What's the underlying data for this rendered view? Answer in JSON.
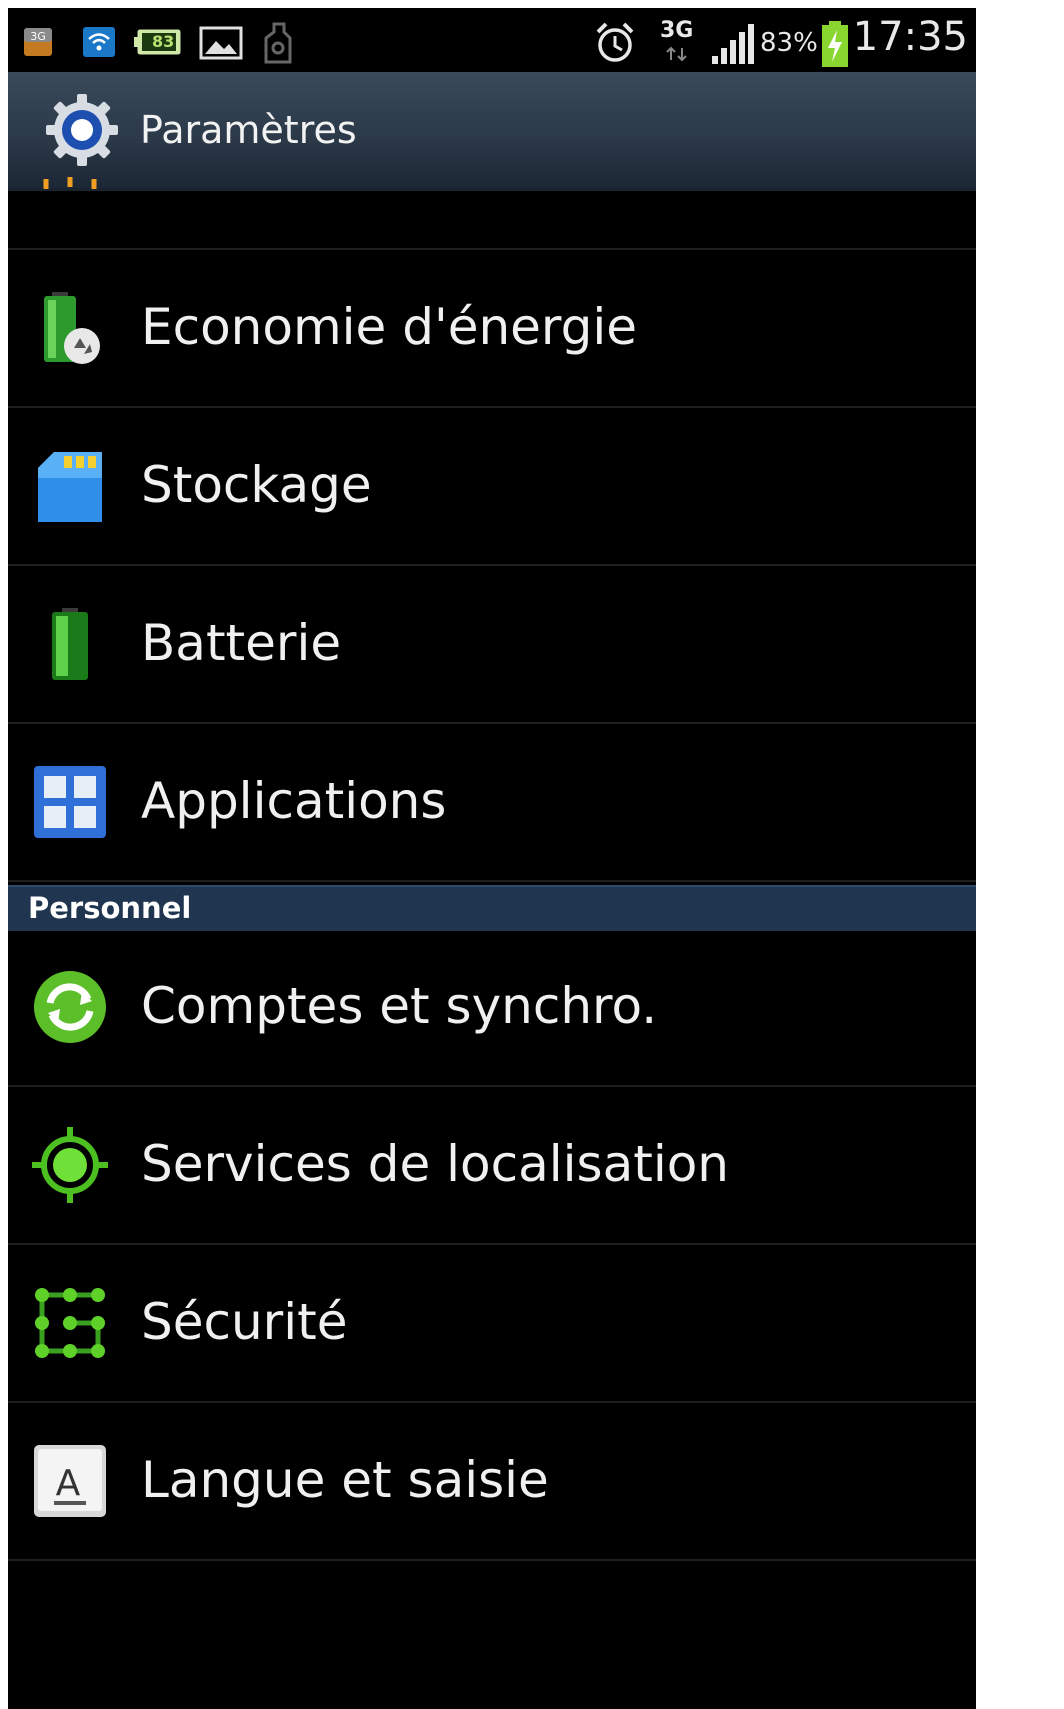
{
  "status_bar": {
    "left_icons": [
      "3g-data-icon",
      "wifi-icon",
      "battery-83-notification-icon",
      "image-icon",
      "usb-icon"
    ],
    "battery_notification_text": "83",
    "network": "3G",
    "battery_percent": "83%",
    "time": "17:35"
  },
  "action_bar": {
    "title": "Paramètres",
    "icon": "gear-icon"
  },
  "list": {
    "items": [
      {
        "label": "Economie d'énergie",
        "icon": "power-saving-icon"
      },
      {
        "label": "Stockage",
        "icon": "sd-card-icon"
      },
      {
        "label": "Batterie",
        "icon": "battery-icon"
      },
      {
        "label": "Applications",
        "icon": "applications-icon"
      }
    ],
    "section_header": "Personnel",
    "personal_items": [
      {
        "label": "Comptes et synchro.",
        "icon": "sync-icon"
      },
      {
        "label": "Services de localisation",
        "icon": "location-icon"
      },
      {
        "label": "Sécurité",
        "icon": "security-pattern-icon"
      },
      {
        "label": "Langue et saisie",
        "icon": "language-keyboard-icon"
      }
    ]
  },
  "colors": {
    "background": "#000000",
    "action_bar": "#2a3848",
    "section_header": "#1f3550",
    "text": "#f0f0f0",
    "accent_green": "#5fd02a",
    "accent_blue": "#2f7de0"
  }
}
